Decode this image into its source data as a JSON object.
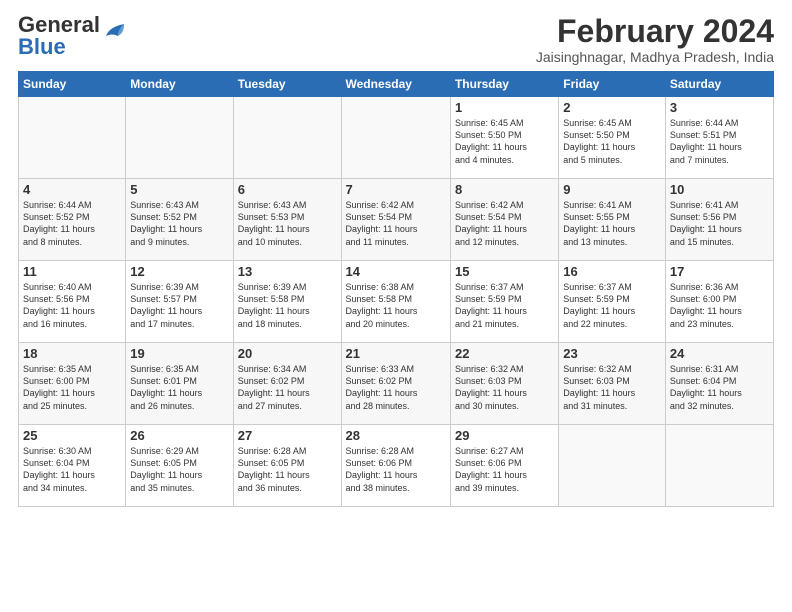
{
  "header": {
    "logo_general": "General",
    "logo_blue": "Blue",
    "month_year": "February 2024",
    "location": "Jaisinghnagar, Madhya Pradesh, India"
  },
  "days_of_week": [
    "Sunday",
    "Monday",
    "Tuesday",
    "Wednesday",
    "Thursday",
    "Friday",
    "Saturday"
  ],
  "weeks": [
    [
      {
        "day": "",
        "info": ""
      },
      {
        "day": "",
        "info": ""
      },
      {
        "day": "",
        "info": ""
      },
      {
        "day": "",
        "info": ""
      },
      {
        "day": "1",
        "info": "Sunrise: 6:45 AM\nSunset: 5:50 PM\nDaylight: 11 hours\nand 4 minutes."
      },
      {
        "day": "2",
        "info": "Sunrise: 6:45 AM\nSunset: 5:50 PM\nDaylight: 11 hours\nand 5 minutes."
      },
      {
        "day": "3",
        "info": "Sunrise: 6:44 AM\nSunset: 5:51 PM\nDaylight: 11 hours\nand 7 minutes."
      }
    ],
    [
      {
        "day": "4",
        "info": "Sunrise: 6:44 AM\nSunset: 5:52 PM\nDaylight: 11 hours\nand 8 minutes."
      },
      {
        "day": "5",
        "info": "Sunrise: 6:43 AM\nSunset: 5:52 PM\nDaylight: 11 hours\nand 9 minutes."
      },
      {
        "day": "6",
        "info": "Sunrise: 6:43 AM\nSunset: 5:53 PM\nDaylight: 11 hours\nand 10 minutes."
      },
      {
        "day": "7",
        "info": "Sunrise: 6:42 AM\nSunset: 5:54 PM\nDaylight: 11 hours\nand 11 minutes."
      },
      {
        "day": "8",
        "info": "Sunrise: 6:42 AM\nSunset: 5:54 PM\nDaylight: 11 hours\nand 12 minutes."
      },
      {
        "day": "9",
        "info": "Sunrise: 6:41 AM\nSunset: 5:55 PM\nDaylight: 11 hours\nand 13 minutes."
      },
      {
        "day": "10",
        "info": "Sunrise: 6:41 AM\nSunset: 5:56 PM\nDaylight: 11 hours\nand 15 minutes."
      }
    ],
    [
      {
        "day": "11",
        "info": "Sunrise: 6:40 AM\nSunset: 5:56 PM\nDaylight: 11 hours\nand 16 minutes."
      },
      {
        "day": "12",
        "info": "Sunrise: 6:39 AM\nSunset: 5:57 PM\nDaylight: 11 hours\nand 17 minutes."
      },
      {
        "day": "13",
        "info": "Sunrise: 6:39 AM\nSunset: 5:58 PM\nDaylight: 11 hours\nand 18 minutes."
      },
      {
        "day": "14",
        "info": "Sunrise: 6:38 AM\nSunset: 5:58 PM\nDaylight: 11 hours\nand 20 minutes."
      },
      {
        "day": "15",
        "info": "Sunrise: 6:37 AM\nSunset: 5:59 PM\nDaylight: 11 hours\nand 21 minutes."
      },
      {
        "day": "16",
        "info": "Sunrise: 6:37 AM\nSunset: 5:59 PM\nDaylight: 11 hours\nand 22 minutes."
      },
      {
        "day": "17",
        "info": "Sunrise: 6:36 AM\nSunset: 6:00 PM\nDaylight: 11 hours\nand 23 minutes."
      }
    ],
    [
      {
        "day": "18",
        "info": "Sunrise: 6:35 AM\nSunset: 6:00 PM\nDaylight: 11 hours\nand 25 minutes."
      },
      {
        "day": "19",
        "info": "Sunrise: 6:35 AM\nSunset: 6:01 PM\nDaylight: 11 hours\nand 26 minutes."
      },
      {
        "day": "20",
        "info": "Sunrise: 6:34 AM\nSunset: 6:02 PM\nDaylight: 11 hours\nand 27 minutes."
      },
      {
        "day": "21",
        "info": "Sunrise: 6:33 AM\nSunset: 6:02 PM\nDaylight: 11 hours\nand 28 minutes."
      },
      {
        "day": "22",
        "info": "Sunrise: 6:32 AM\nSunset: 6:03 PM\nDaylight: 11 hours\nand 30 minutes."
      },
      {
        "day": "23",
        "info": "Sunrise: 6:32 AM\nSunset: 6:03 PM\nDaylight: 11 hours\nand 31 minutes."
      },
      {
        "day": "24",
        "info": "Sunrise: 6:31 AM\nSunset: 6:04 PM\nDaylight: 11 hours\nand 32 minutes."
      }
    ],
    [
      {
        "day": "25",
        "info": "Sunrise: 6:30 AM\nSunset: 6:04 PM\nDaylight: 11 hours\nand 34 minutes."
      },
      {
        "day": "26",
        "info": "Sunrise: 6:29 AM\nSunset: 6:05 PM\nDaylight: 11 hours\nand 35 minutes."
      },
      {
        "day": "27",
        "info": "Sunrise: 6:28 AM\nSunset: 6:05 PM\nDaylight: 11 hours\nand 36 minutes."
      },
      {
        "day": "28",
        "info": "Sunrise: 6:28 AM\nSunset: 6:06 PM\nDaylight: 11 hours\nand 38 minutes."
      },
      {
        "day": "29",
        "info": "Sunrise: 6:27 AM\nSunset: 6:06 PM\nDaylight: 11 hours\nand 39 minutes."
      },
      {
        "day": "",
        "info": ""
      },
      {
        "day": "",
        "info": ""
      }
    ]
  ]
}
